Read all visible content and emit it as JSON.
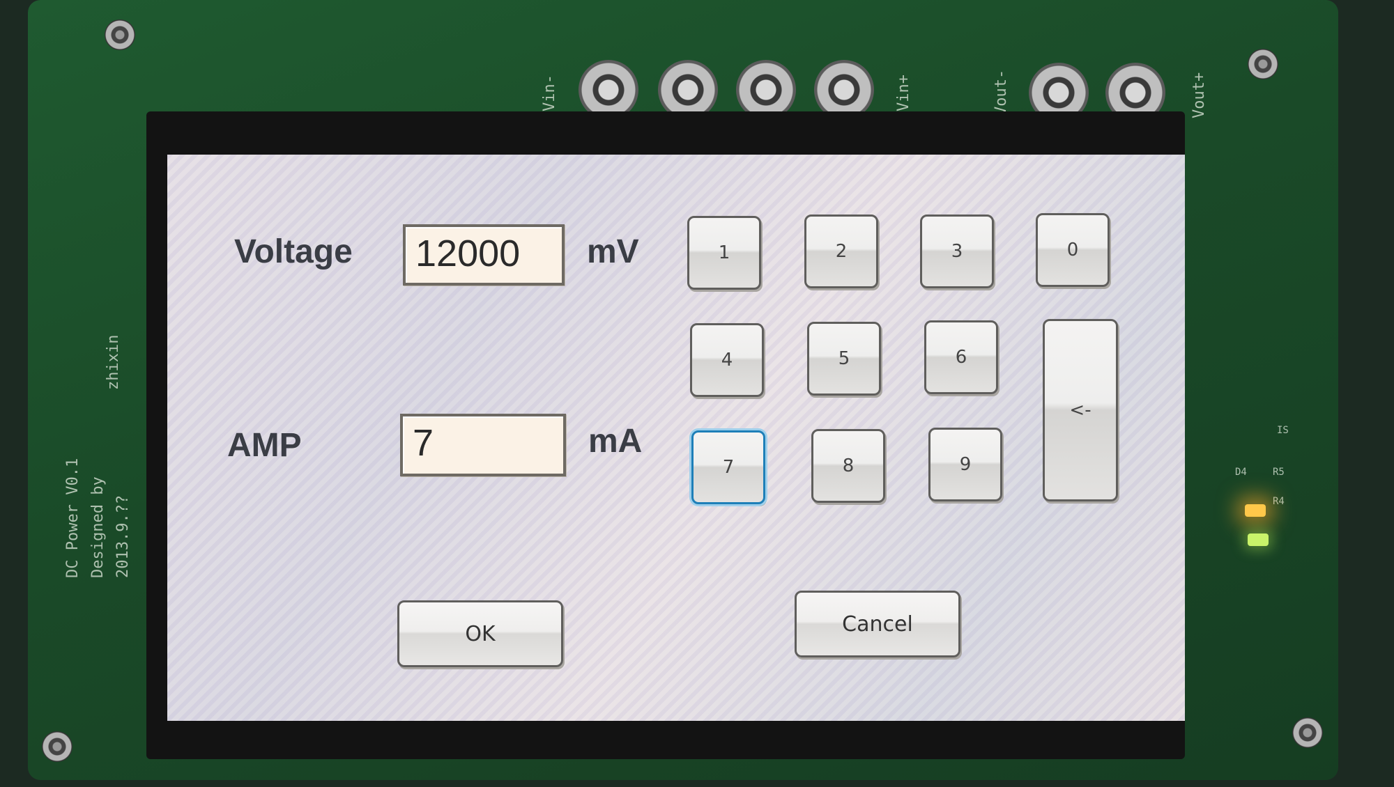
{
  "board": {
    "silk_vin_minus": "Vin-",
    "silk_vin_plus": "Vin+",
    "silk_vout_minus": "Vout-",
    "silk_vout_plus": "Vout+",
    "silk_title": "DC Power V0.1",
    "silk_designer": "Designed by",
    "silk_designer_name": "zhixin",
    "silk_date": "2013.9.??",
    "silk_d4": "D4",
    "silk_r5": "R5",
    "silk_r4": "R4",
    "silk_is": "IS"
  },
  "form": {
    "voltage_label": "Voltage",
    "voltage_value": "12000",
    "voltage_unit": "mV",
    "amp_label": "AMP",
    "amp_value": "7",
    "amp_unit": "mA"
  },
  "keypad": {
    "k1": "1",
    "k2": "2",
    "k3": "3",
    "k0": "0",
    "k4": "4",
    "k5": "5",
    "k6": "6",
    "backspace": "<-",
    "k7": "7",
    "k8": "8",
    "k9": "9"
  },
  "actions": {
    "ok": "OK",
    "cancel": "Cancel"
  },
  "colors": {
    "accent_focus": "#1e7fb8",
    "led_amber": "#ffc84a",
    "led_green": "#c9f36a"
  }
}
